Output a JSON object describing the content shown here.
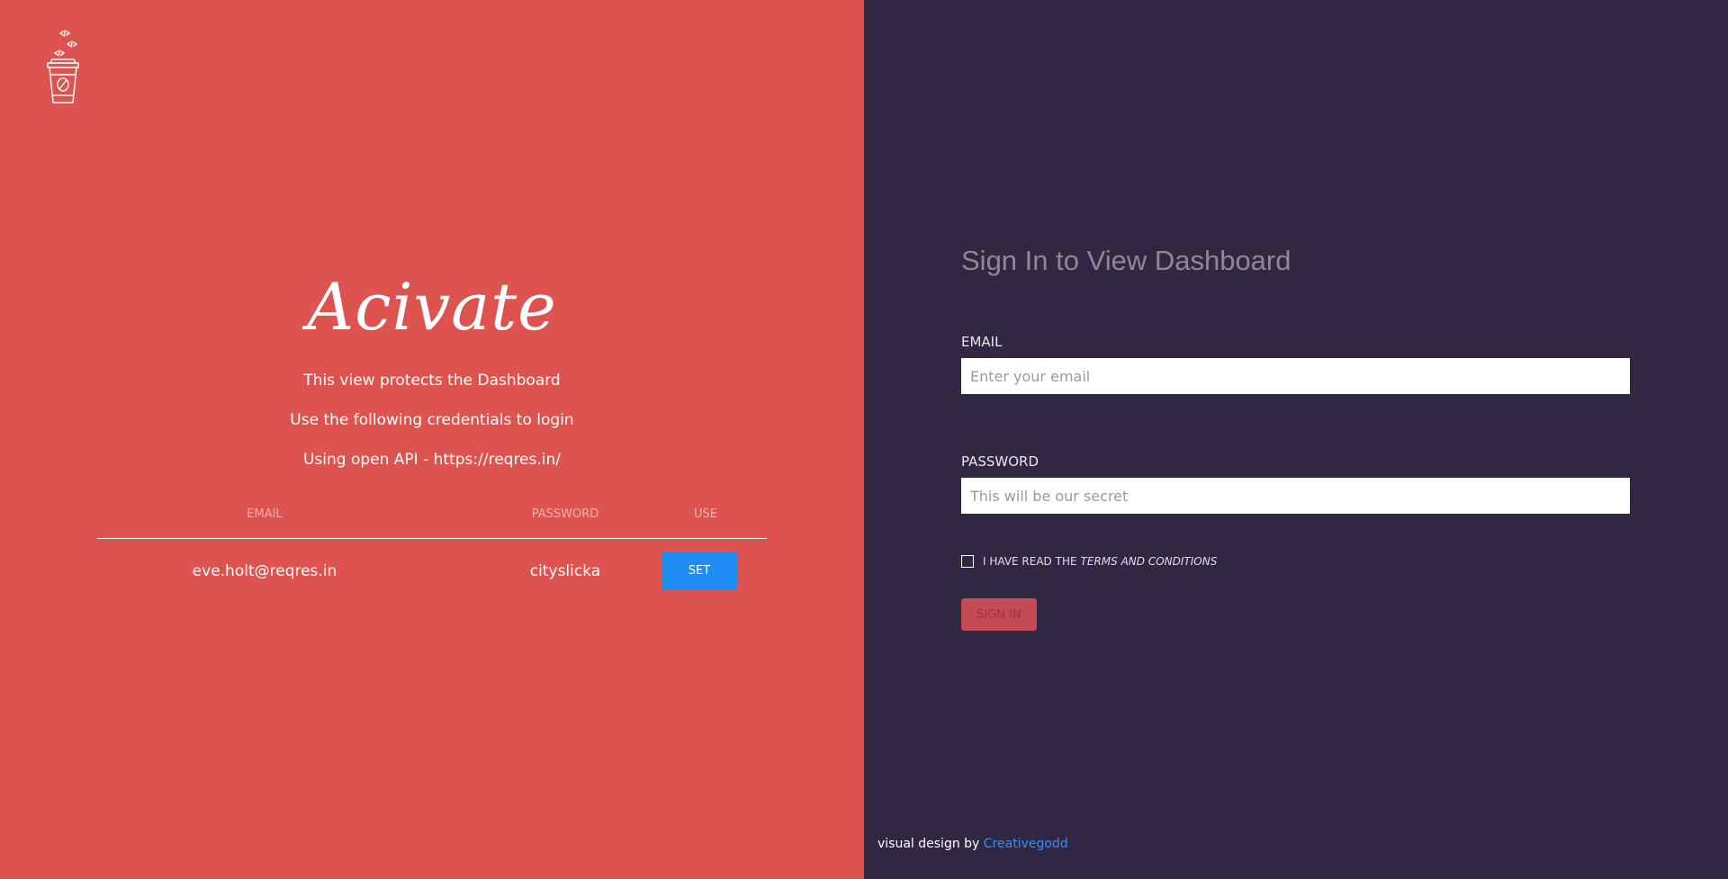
{
  "left_panel": {
    "brand": "Acivate",
    "info_lines": [
      "This view protects the Dashboard",
      "Use the following credentials to login",
      "Using open API - https://reqres.in/"
    ],
    "table": {
      "headers": [
        "EMAIL",
        "PASSWORD",
        "USE"
      ],
      "rows": [
        {
          "email": "eve.holt@reqres.in",
          "password": "cityslicka",
          "action": "SET"
        }
      ]
    },
    "colors": {
      "background": "#dc534f",
      "button": "#1f8cf2"
    }
  },
  "right_panel": {
    "title": "Sign In to View Dashboard",
    "email": {
      "label": "EMAIL",
      "placeholder": "Enter your email"
    },
    "password": {
      "label": "PASSWORD",
      "placeholder": "This will be our secret"
    },
    "terms": {
      "prefix": "I HAVE READ THE",
      "link": "TERMS AND CONDITIONS"
    },
    "submit_label": "SIGN IN",
    "colors": {
      "background": "#302843"
    }
  },
  "footer": {
    "credit_prefix": "visual design by",
    "credit_link": "Creativegodd"
  },
  "icons": {
    "logo": "coffee-cup-code-icon"
  }
}
